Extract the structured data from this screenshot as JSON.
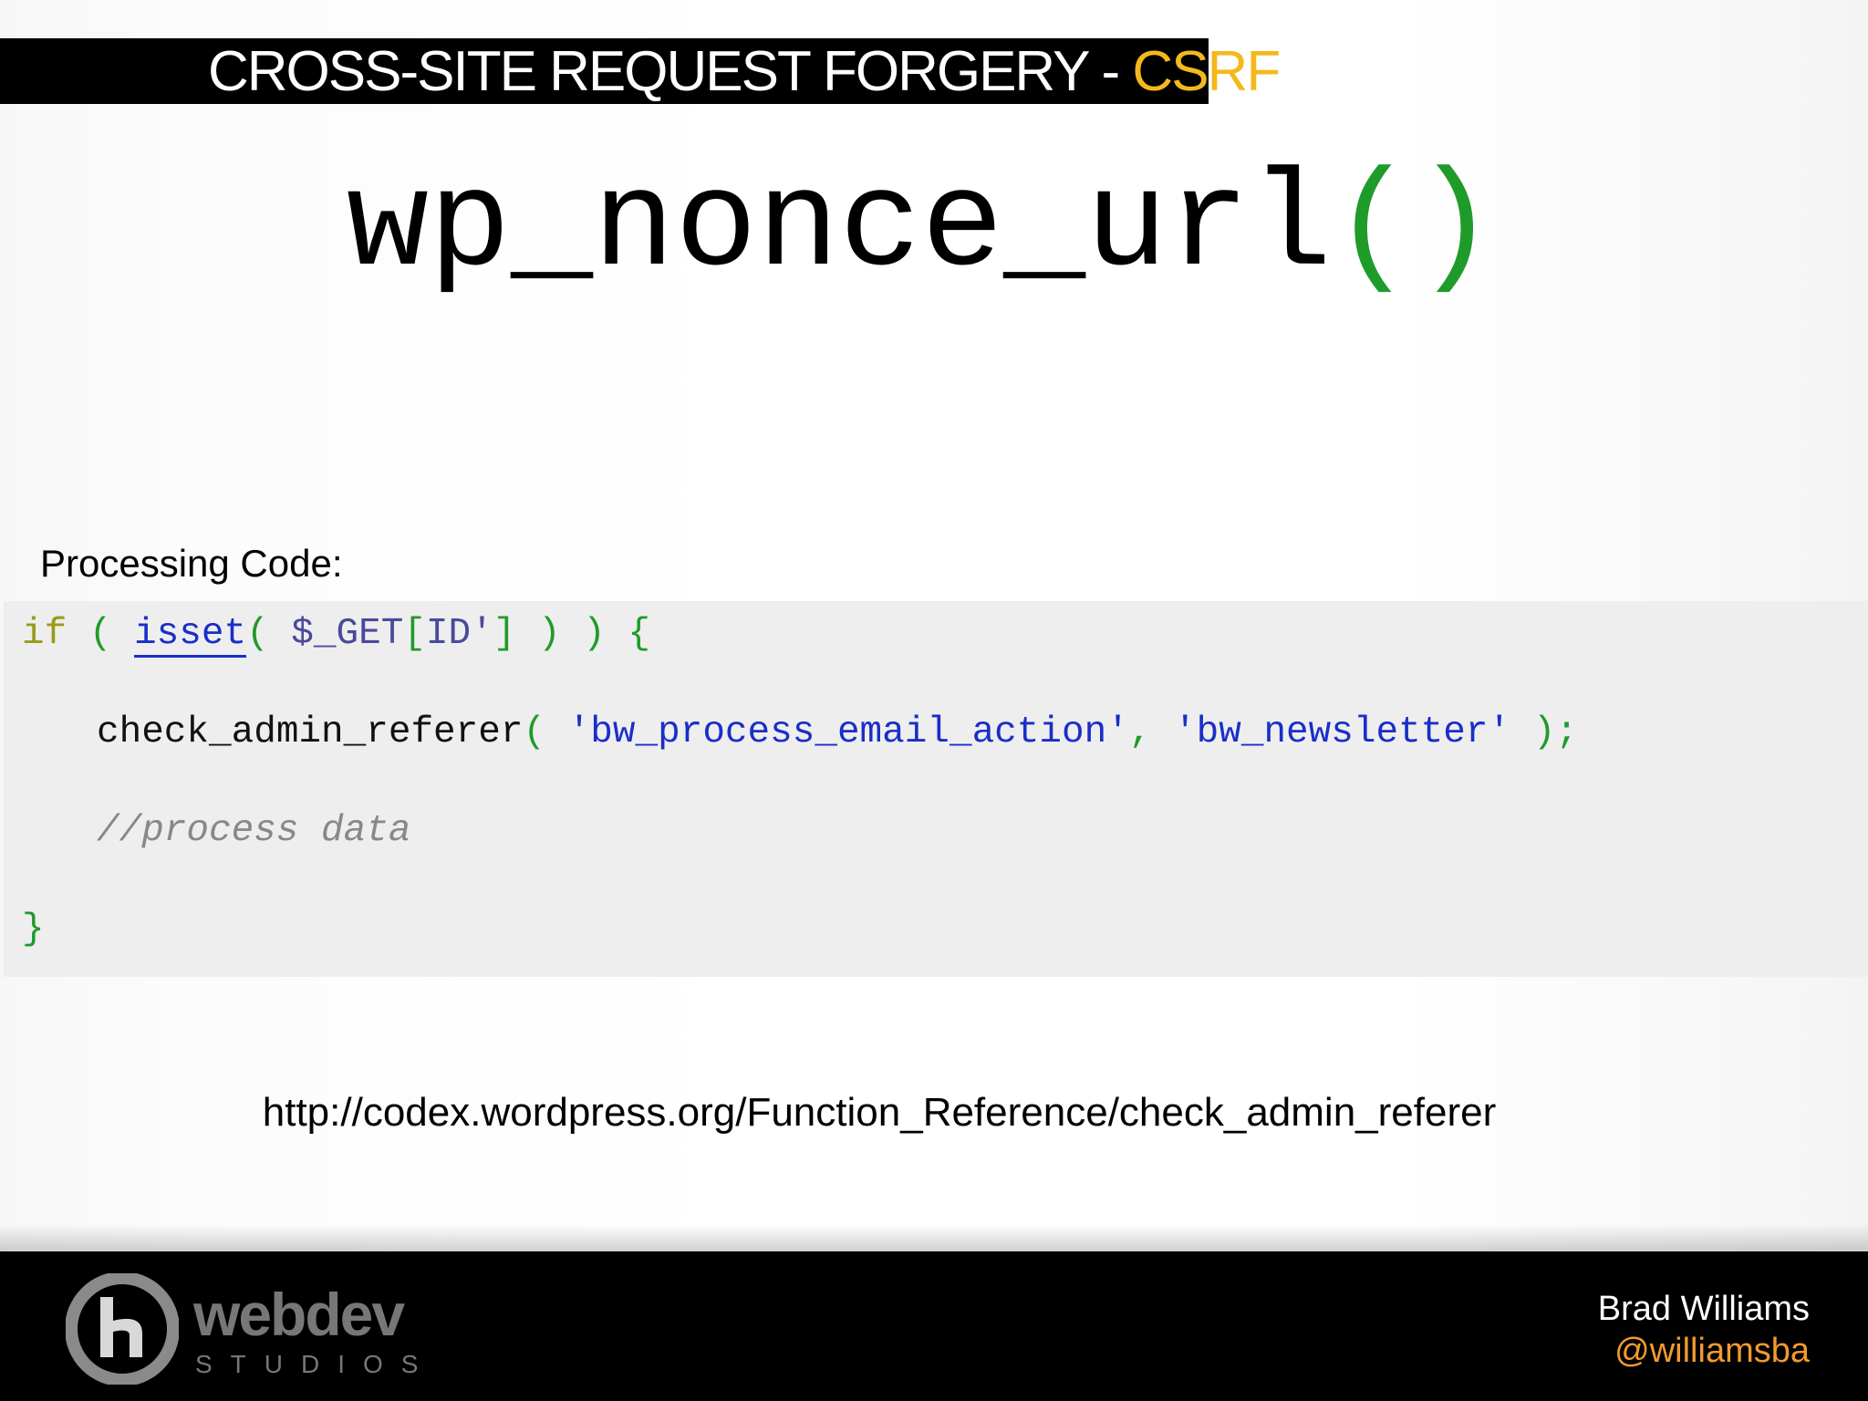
{
  "slide": {
    "title_main": "CROSS-SITE REQUEST FORGERY - ",
    "title_accent": "CSRF",
    "function_name": "wp_nonce_url",
    "function_parens": "()",
    "processing_label": "Processing Code:",
    "reference_url": "http://codex.wordpress.org/Function_Reference/check_admin_referer"
  },
  "code": {
    "line1": {
      "if": "if",
      "open": " ( ",
      "isset": "isset",
      "paren": "( ",
      "var": "$_GET",
      "bracket_open": "[",
      "key": "ID'",
      "bracket_close": "]",
      "close": " ) ) {"
    },
    "line2": {
      "func": "check_admin_referer",
      "open": "( ",
      "arg1": "'bw_process_email_action'",
      "comma": ", ",
      "arg2": "'bw_newsletter'",
      "close": " );"
    },
    "line3": {
      "comment": "//process data"
    },
    "line4": {
      "brace": "}"
    }
  },
  "footer": {
    "logo_word": "webdev",
    "logo_sub": "STUDIOS",
    "author_name": "Brad Williams",
    "author_handle": "@williamsba"
  },
  "colors": {
    "title_accent": "#f5b81c",
    "paren_green": "#1f9b2a",
    "code_blue": "#1a2ec8",
    "keyword_olive": "#9a9a1a",
    "handle_orange": "#f29a2e"
  }
}
